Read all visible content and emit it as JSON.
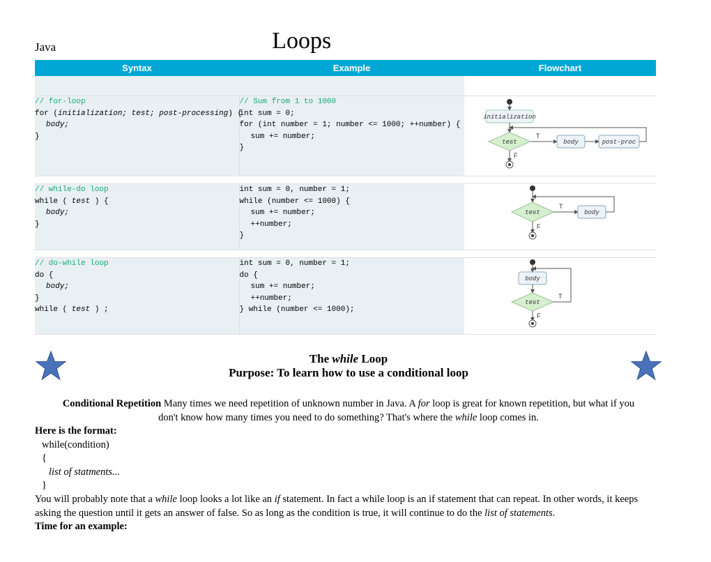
{
  "header": {
    "lang": "Java",
    "title": "Loops"
  },
  "table": {
    "columns": [
      "Syntax",
      "Example",
      "Flowchart"
    ],
    "rows": [
      {
        "syntax_comment": "// for-loop",
        "syntax_l1": "for (",
        "syntax_l1b": "initialization; test; post-processing",
        "syntax_l1c": ") {",
        "syntax_l2": "body;",
        "syntax_l3": "}",
        "ex_comment": "// Sum from 1 to 1000",
        "ex_l1": "int sum = 0;",
        "ex_l2": "for (int number = 1; number <= 1000; ++number) {",
        "ex_l3": "sum += number;",
        "ex_l4": "}",
        "fc": {
          "init": "initialization",
          "test": "test",
          "body": "body",
          "post": "post-proc",
          "t": "T",
          "f": "F"
        }
      },
      {
        "syntax_comment": "// while-do loop",
        "syntax_l1": "while ( ",
        "syntax_l1b": "test",
        "syntax_l1c": " ) {",
        "syntax_l2": "body;",
        "syntax_l3": "}",
        "ex_l1": "int sum = 0, number = 1;",
        "ex_l2": "while (number <= 1000) {",
        "ex_l3": "sum += number;",
        "ex_l4": "++number;",
        "ex_l5": "}",
        "fc": {
          "test": "test",
          "body": "body",
          "t": "T",
          "f": "F"
        }
      },
      {
        "syntax_comment": "// do-while loop",
        "syntax_l1": "do {",
        "syntax_l2": "body;",
        "syntax_l3": "}",
        "syntax_l4": "while ( ",
        "syntax_l4b": "test",
        "syntax_l4c": " ) ;",
        "ex_l1": "int sum = 0, number = 1;",
        "ex_l2": "do {",
        "ex_l3": "sum += number;",
        "ex_l4": "++number;",
        "ex_l5": "} while (number <= 1000);",
        "fc": {
          "test": "test",
          "body": "body",
          "t": "T",
          "f": "F"
        }
      }
    ]
  },
  "subtitle": {
    "line1a": "The ",
    "line1b": "while",
    "line1c": " Loop",
    "line2": "Purpose: To learn how to use a conditional loop"
  },
  "body": {
    "p1_bold": "Conditional Repetition",
    "p1_a": "  Many times we need repetition of unknown number in Java. A ",
    "p1_for": "for",
    "p1_b": " loop is great for known repetition, but what if you",
    "p1_c": "don't know how many times you need to do something? That's where the ",
    "p1_while": "while",
    "p1_d": " loop comes in.",
    "format_hdr": "Here is the format:",
    "code_l1": "while(condition)",
    "code_l2": "{",
    "code_l3": "list of statments...",
    "code_l4": "}",
    "p2_a": "You will probably note that a ",
    "p2_while": "while",
    "p2_b": " loop looks a lot like an ",
    "p2_if": "if",
    "p2_c": " statement. In fact a while loop is an if statement that can repeat. In other words, it keeps asking the question until it gets an answer of false. So as long as the condition is true, it will continue to do the ",
    "p2_list": "list of statements",
    "p2_d": ".",
    "example_hdr": "Time for an example:"
  }
}
